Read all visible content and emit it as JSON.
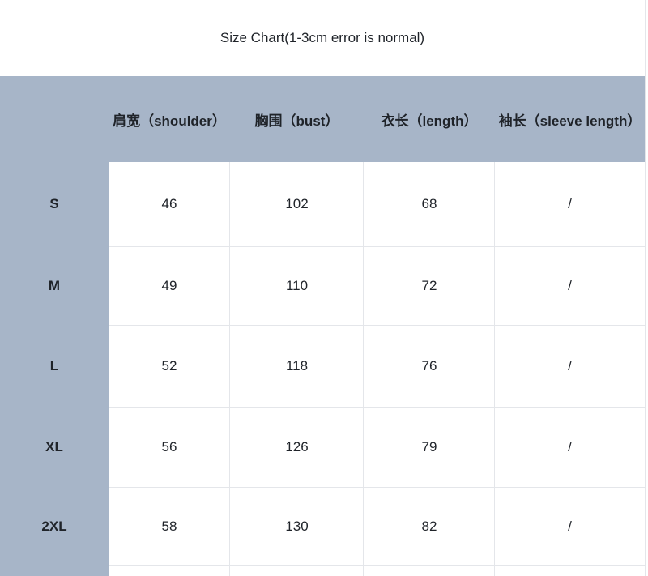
{
  "title": "Size Chart(1-3cm error is normal)",
  "headers": [
    "",
    "肩宽（shoulder）",
    "胸围（bust）",
    "衣长（length）",
    "袖长（sleeve length）"
  ],
  "rows": [
    {
      "size": "S",
      "shoulder": "46",
      "bust": "102",
      "length": "68",
      "sleeve": "/"
    },
    {
      "size": "M",
      "shoulder": "49",
      "bust": "110",
      "length": "72",
      "sleeve": "/"
    },
    {
      "size": "L",
      "shoulder": "52",
      "bust": "118",
      "length": "76",
      "sleeve": "/"
    },
    {
      "size": "XL",
      "shoulder": "56",
      "bust": "126",
      "length": "79",
      "sleeve": "/"
    },
    {
      "size": "2XL",
      "shoulder": "58",
      "bust": "130",
      "length": "82",
      "sleeve": "/"
    }
  ],
  "colors": {
    "header_band": "#a7b5c8",
    "grid_line": "#e4e6ea",
    "text": "#1f2329"
  }
}
